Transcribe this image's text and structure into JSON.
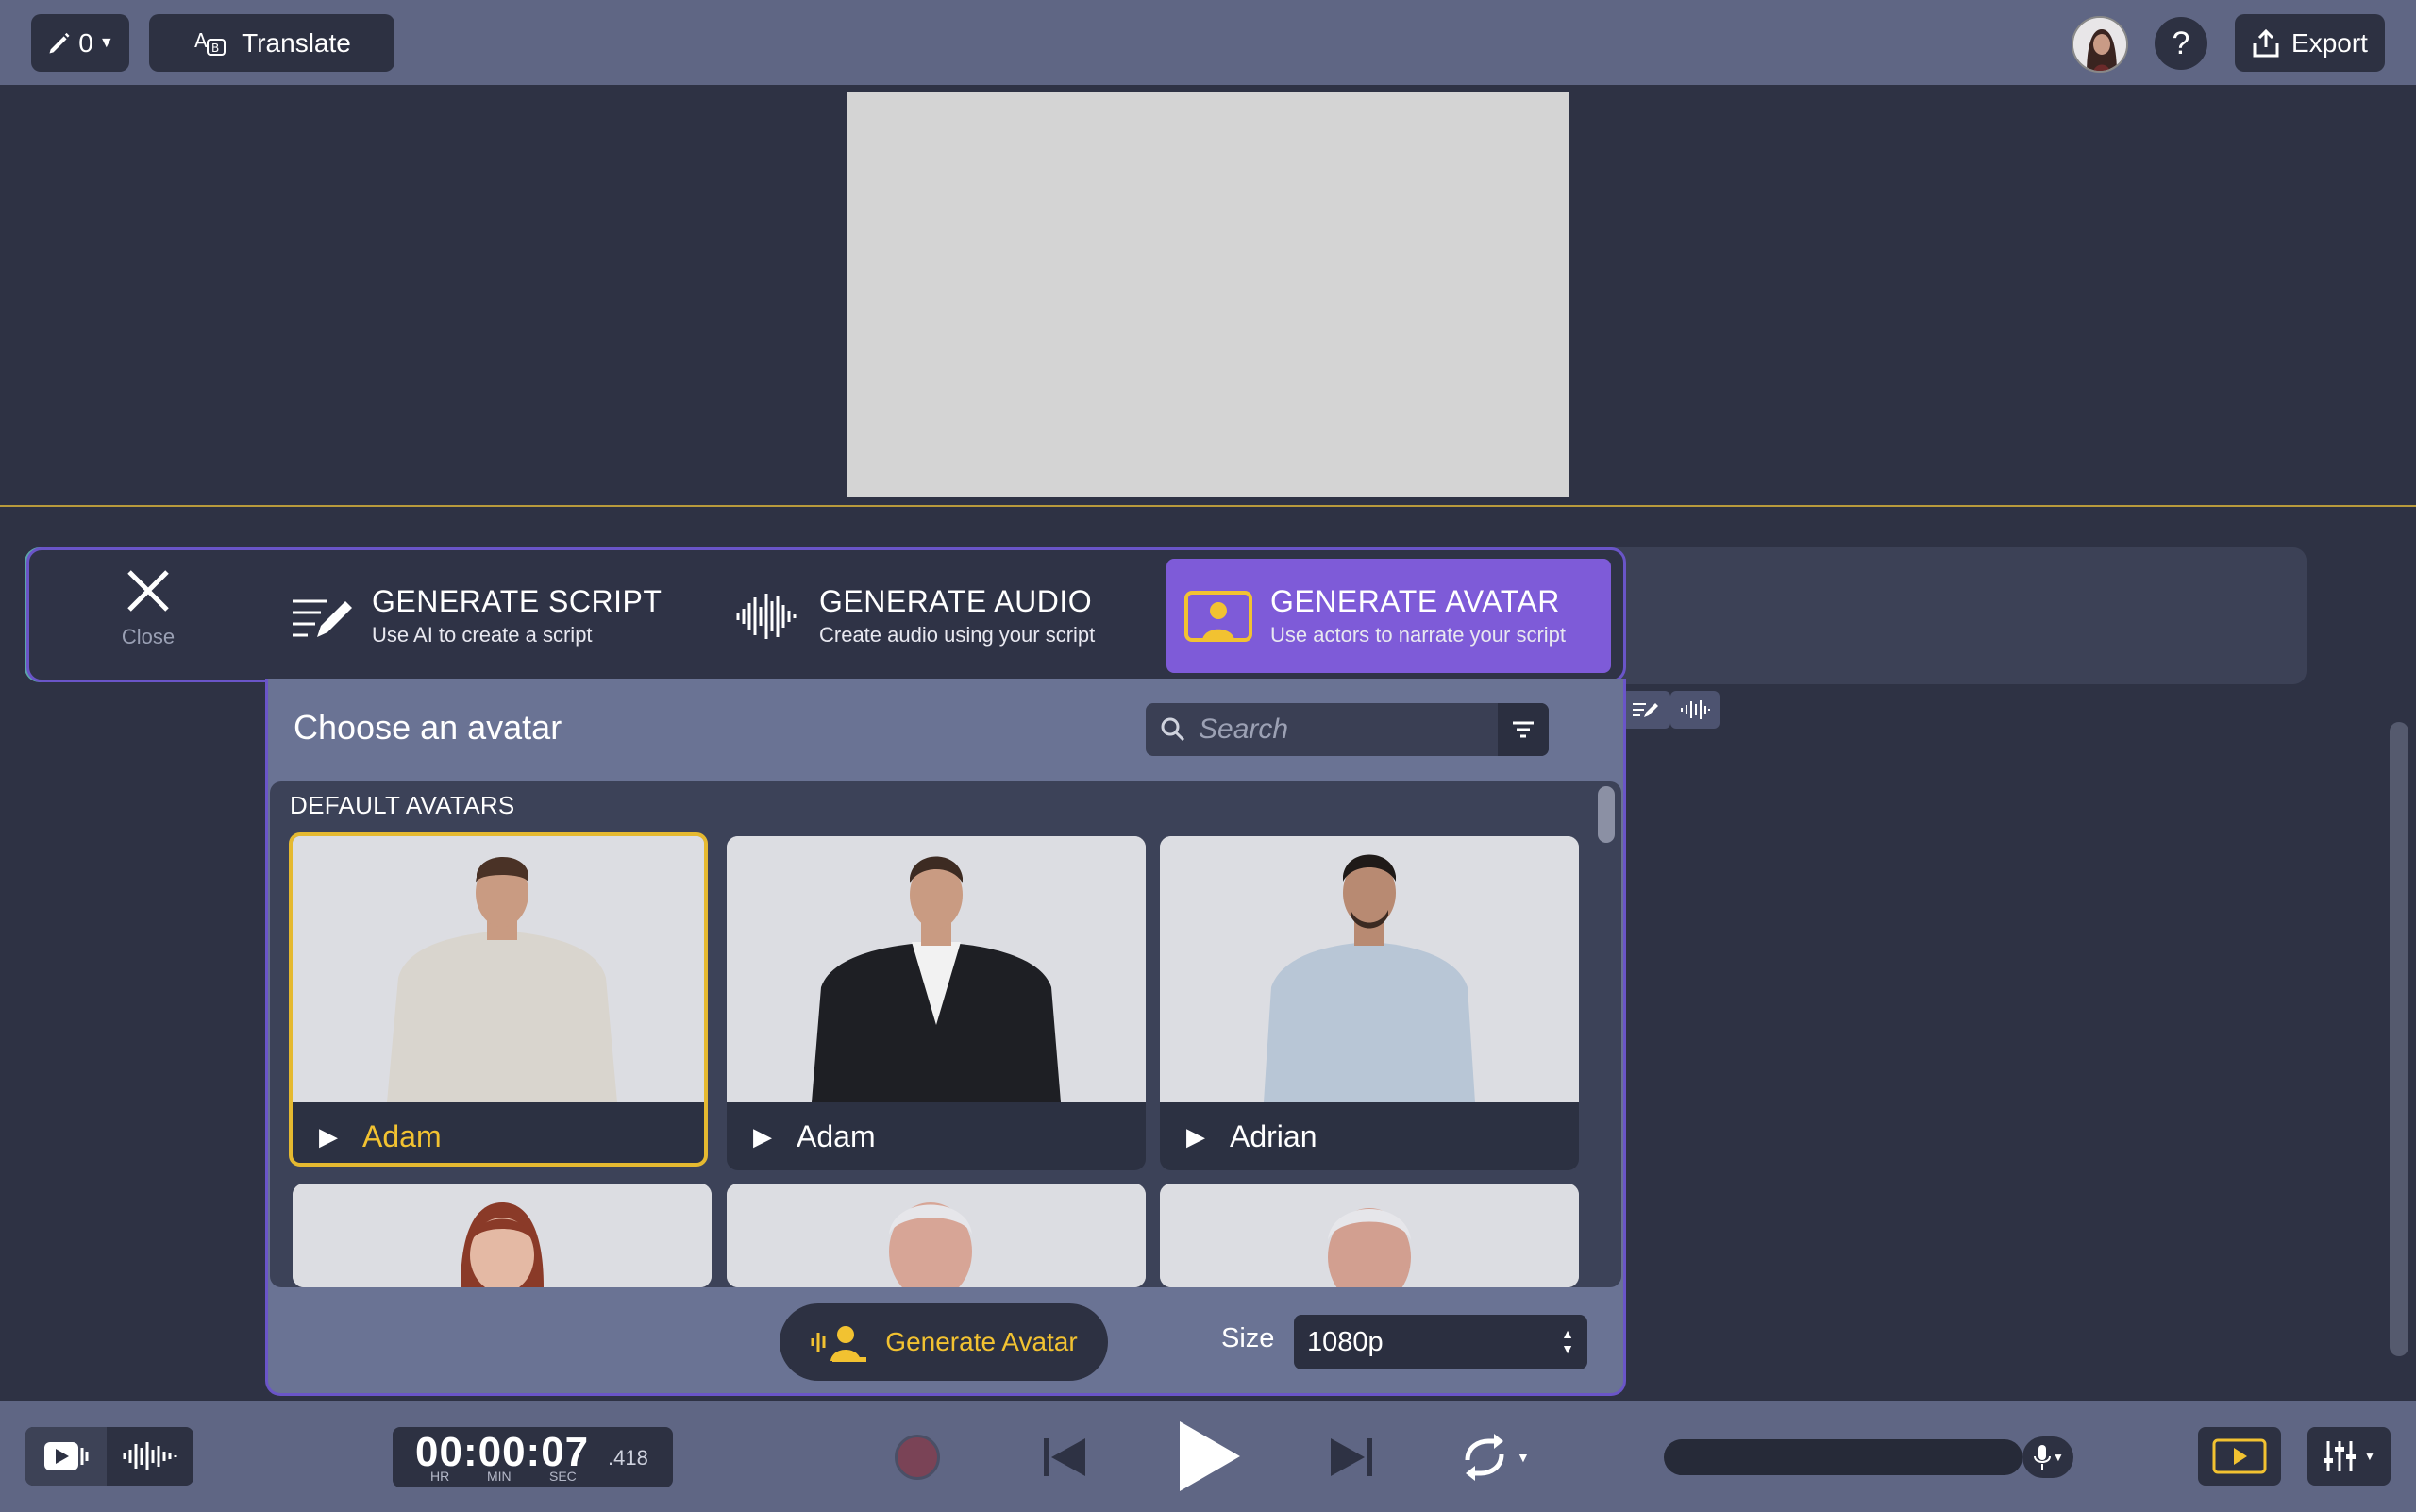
{
  "topbar": {
    "pencil_count": "0",
    "translate_label": "Translate",
    "help_label": "?",
    "export_label": "Export"
  },
  "panel": {
    "close_label": "Close",
    "tabs": [
      {
        "title": "GENERATE SCRIPT",
        "subtitle": "Use AI to create a script",
        "icon": "script-pen-icon"
      },
      {
        "title": "GENERATE AUDIO",
        "subtitle": "Create audio using your script",
        "icon": "waveform-icon"
      },
      {
        "title": "GENERATE AVATAR",
        "subtitle": "Use actors to narrate your script",
        "icon": "avatar-frame-icon",
        "active": true
      }
    ],
    "choose_title": "Choose an avatar",
    "search_placeholder": "Search",
    "section_label": "DEFAULT AVATARS",
    "avatars": [
      {
        "name": "Adam",
        "selected": true
      },
      {
        "name": "Adam",
        "selected": false
      },
      {
        "name": "Adrian",
        "selected": false
      }
    ],
    "generate_label": "Generate Avatar",
    "size_label": "Size",
    "size_value": "1080p"
  },
  "transport": {
    "timecode": "00:00:07",
    "milliseconds": ".418",
    "unit_hr": "HR",
    "unit_min": "MIN",
    "unit_sec": "SEC"
  },
  "colors": {
    "accent_purple": "#7e5bd8",
    "accent_yellow": "#f2c231",
    "bar": "#5f6684"
  }
}
